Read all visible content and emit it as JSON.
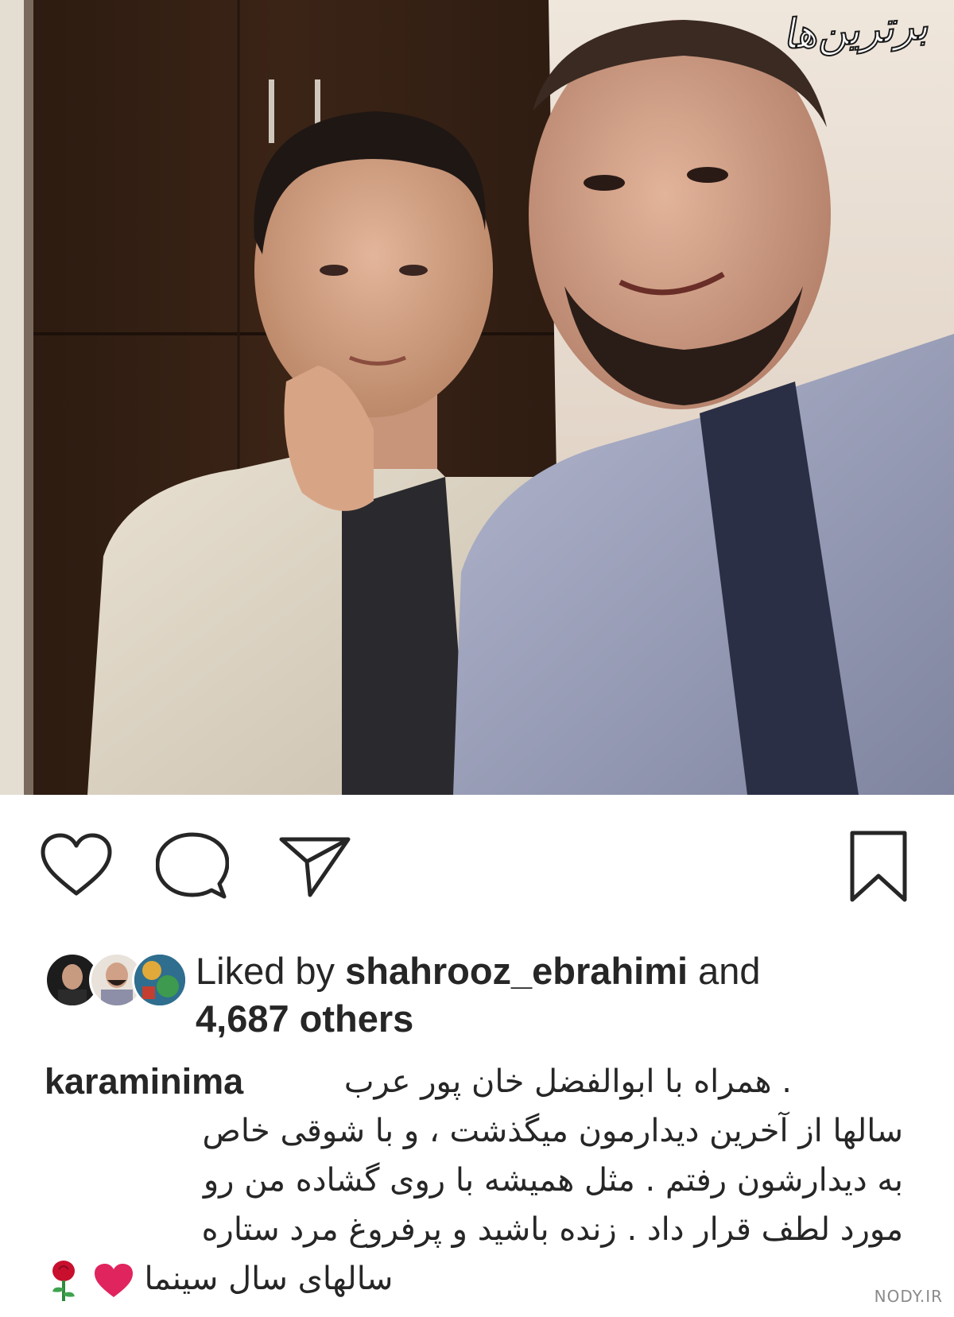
{
  "photo": {
    "watermark_text": "برترین‌ها"
  },
  "actions": {
    "like_icon": "heart-outline-icon",
    "comment_icon": "comment-bubble-icon",
    "share_icon": "paper-plane-icon",
    "save_icon": "bookmark-icon"
  },
  "likes": {
    "prefix": "Liked by ",
    "username": "shahrooz_ebrahimi",
    "and": " and",
    "others": "4,687 others"
  },
  "caption": {
    "username": "karaminima",
    "lines": [
      ". همراه با ابوالفضل خان پور عرب",
      "سالها از آخرین دیدارمون میگذشت ، و با شوقی خاص",
      "به دیدارشون رفتم . مثل همیشه با روی گشاده من رو",
      "مورد لطف قرار داد . زنده باشید و پرفروغ مرد ستاره",
      "سالهای سال سینما"
    ]
  },
  "footer": {
    "site": "NODY.IR"
  },
  "colors": {
    "text": "#262626",
    "heart": "#e0245e",
    "rose": "#c8102e"
  }
}
